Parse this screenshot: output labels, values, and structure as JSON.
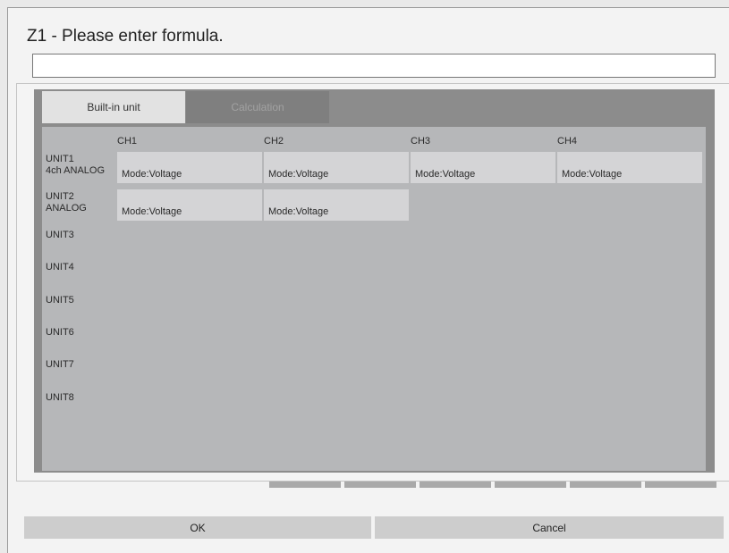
{
  "dialog": {
    "title": "Z1 - Please enter formula.",
    "formula_value": ""
  },
  "tabs": [
    {
      "label": "Built-in unit",
      "active": true
    },
    {
      "label": "Calculation",
      "active": false
    }
  ],
  "channel_headers": [
    "CH1",
    "CH2",
    "CH3",
    "CH4"
  ],
  "units": [
    {
      "name": "UNIT1",
      "subtitle": "4ch ANALOG",
      "channels": [
        "Mode:Voltage",
        "Mode:Voltage",
        "Mode:Voltage",
        "Mode:Voltage"
      ]
    },
    {
      "name": "UNIT2",
      "subtitle": "ANALOG",
      "channels": [
        "Mode:Voltage",
        "Mode:Voltage"
      ]
    },
    {
      "name": "UNIT3",
      "subtitle": "",
      "channels": []
    },
    {
      "name": "UNIT4",
      "subtitle": "",
      "channels": []
    },
    {
      "name": "UNIT5",
      "subtitle": "",
      "channels": []
    },
    {
      "name": "UNIT6",
      "subtitle": "",
      "channels": []
    },
    {
      "name": "UNIT7",
      "subtitle": "",
      "channels": []
    },
    {
      "name": "UNIT8",
      "subtitle": "",
      "channels": []
    }
  ],
  "buttons": {
    "ok": "OK",
    "cancel": "Cancel"
  },
  "colors": {
    "panel_background": "#8c8c8c",
    "grid_background": "#b6b7b9",
    "cell_background": "#d4d4d6",
    "active_tab": "#e2e2e2",
    "inactive_tab": "#7f7f7f",
    "button_background": "#cdcdcd"
  }
}
